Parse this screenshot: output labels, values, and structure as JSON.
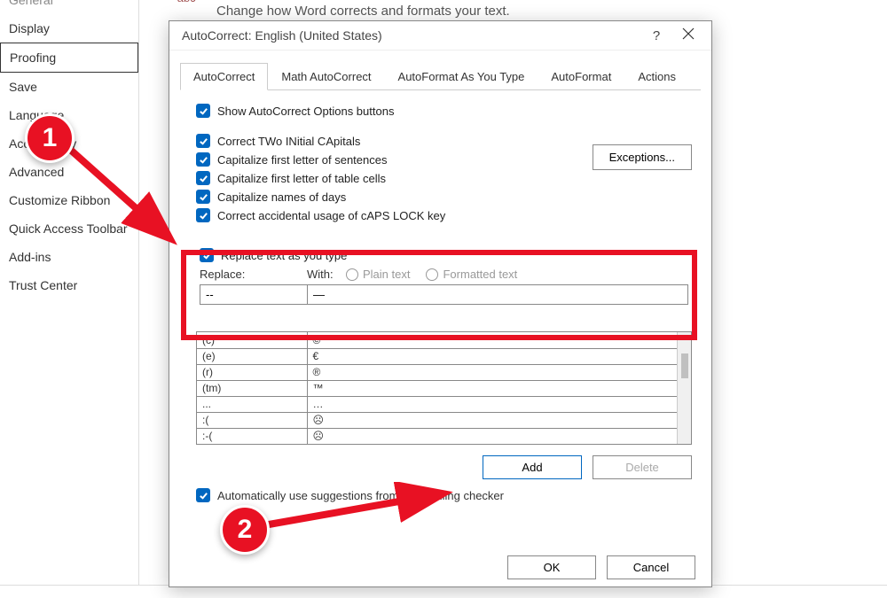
{
  "sidebar": {
    "items": [
      {
        "label": "General",
        "truncated": true
      },
      {
        "label": "Display"
      },
      {
        "label": "Proofing",
        "selected": true
      },
      {
        "label": "Save"
      },
      {
        "label": "Language"
      },
      {
        "label": "Accessibility"
      },
      {
        "label": "Advanced"
      },
      {
        "label": "Customize Ribbon"
      },
      {
        "label": "Quick Access Toolbar"
      },
      {
        "label": "Add-ins"
      },
      {
        "label": "Trust Center"
      }
    ]
  },
  "main": {
    "abc_icon": "abc",
    "heading": "Change how Word corrects and formats your text."
  },
  "dialog": {
    "title": "AutoCorrect: English (United States)",
    "help": "?",
    "tabs": [
      {
        "label": "AutoCorrect",
        "active": true
      },
      {
        "label": "Math AutoCorrect"
      },
      {
        "label": "AutoFormat As You Type"
      },
      {
        "label": "AutoFormat"
      },
      {
        "label": "Actions"
      }
    ],
    "checks": {
      "show_buttons": "Show AutoCorrect Options buttons",
      "two_initial": "Correct TWo INitial CApitals",
      "first_sentence": "Capitalize first letter of sentences",
      "first_cells": "Capitalize first letter of table cells",
      "names_days": "Capitalize names of days",
      "caps_lock": "Correct accidental usage of cAPS LOCK key"
    },
    "exceptions_btn": "Exceptions...",
    "replace": {
      "check_label": "Replace text as you type",
      "replace_label": "Replace:",
      "with_label": "With:",
      "plain_text": "Plain text",
      "formatted_text": "Formatted text",
      "replace_value": "--",
      "with_value": "—"
    },
    "table": {
      "rows": [
        {
          "from": "(c)",
          "to": "©"
        },
        {
          "from": "(e)",
          "to": "€"
        },
        {
          "from": "(r)",
          "to": "®"
        },
        {
          "from": "(tm)",
          "to": "™"
        },
        {
          "from": "...",
          "to": "…"
        },
        {
          "from": ":(",
          "to": "☹"
        },
        {
          "from": ":-(",
          "to": "☹"
        }
      ]
    },
    "add_btn": "Add",
    "delete_btn": "Delete",
    "spell_check": "Automatically use suggestions from the spelling checker",
    "ok_btn": "OK",
    "cancel_btn": "Cancel"
  },
  "annotations": {
    "one": "1",
    "two": "2"
  }
}
